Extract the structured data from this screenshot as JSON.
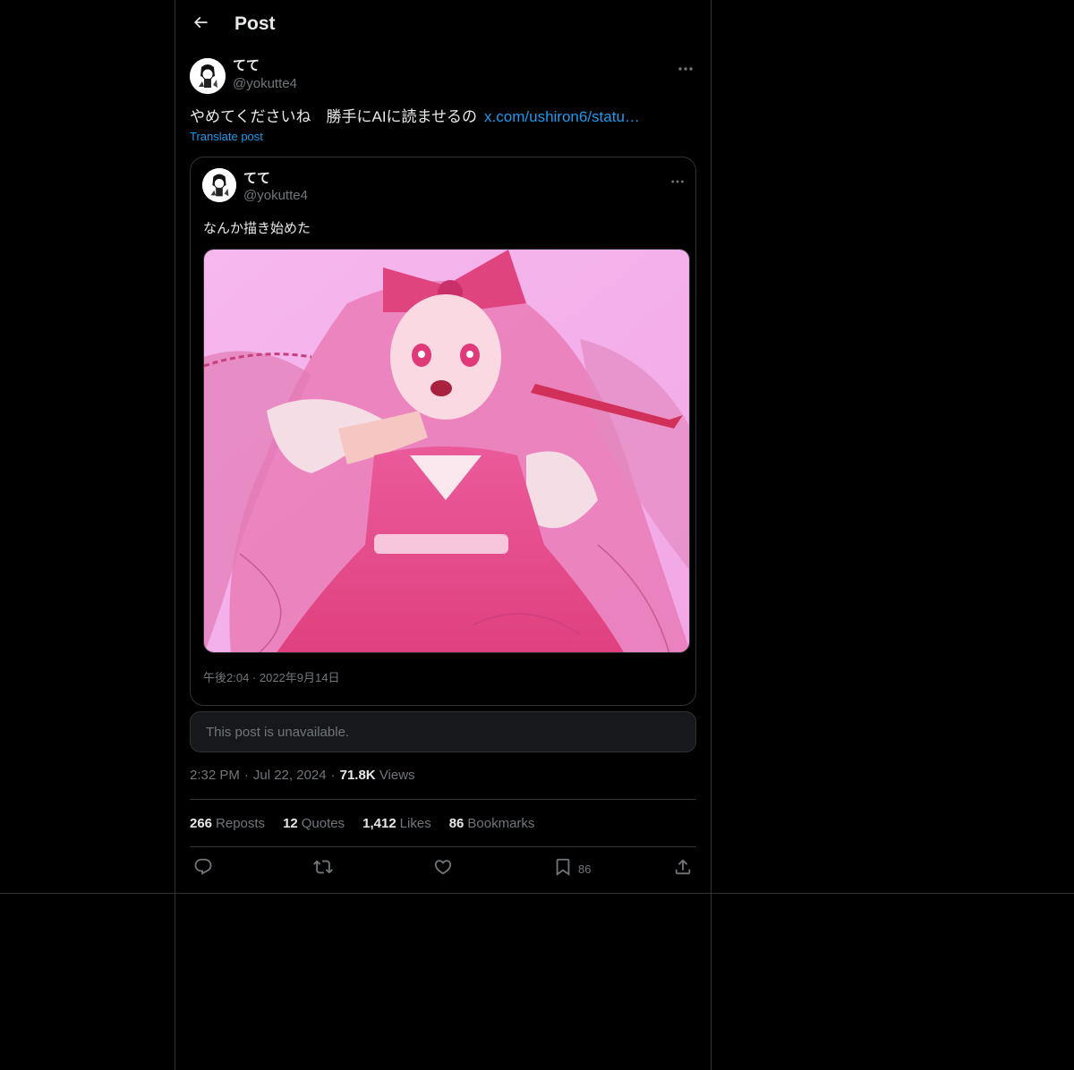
{
  "header": {
    "title": "Post",
    "back_icon": "arrow-left-icon"
  },
  "post": {
    "author": {
      "name": "てて",
      "handle": "@yokutte4",
      "avatar_icon": "avatar-icon"
    },
    "text": "やめてくださいね　勝手にAIに読ませるの",
    "link_text": "x.com/ushiron6/statu…",
    "translate_label": "Translate post",
    "more_icon": "more-horizontal-icon"
  },
  "quote": {
    "author": {
      "name": "てて",
      "handle": "@yokutte4"
    },
    "text": "なんか描き始めた",
    "image_alt": "pink-haired-girl-illustration",
    "timestamp": "午後2:04 · 2022年9月14日"
  },
  "unavailable": {
    "text": "This post is unavailable."
  },
  "meta": {
    "time": "2:32 PM",
    "date": "Jul 22, 2024",
    "views_count": "71.8K",
    "views_label": "Views"
  },
  "stats": [
    {
      "count": "266",
      "label": "Reposts"
    },
    {
      "count": "12",
      "label": "Quotes"
    },
    {
      "count": "1,412",
      "label": "Likes"
    },
    {
      "count": "86",
      "label": "Bookmarks"
    }
  ],
  "actions": {
    "bookmark_count": "86"
  },
  "colors": {
    "accent": "#1d9bf0",
    "text": "#e7e9ea",
    "muted": "#71767b",
    "border": "#2f3336",
    "background": "#000000"
  }
}
